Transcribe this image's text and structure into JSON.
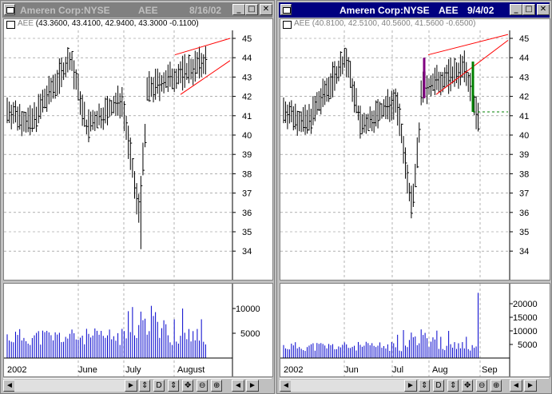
{
  "left": {
    "title": {
      "name": "Ameren Corp:NYSE",
      "symbol": "AEE",
      "date": "8/16/02"
    },
    "info": {
      "symbol": "AEE",
      "values": "(43.3600, 43.4100, 42.9400, 43.3000 -0.1100)"
    },
    "price_ticks": [
      "45",
      "44",
      "43",
      "42",
      "41",
      "40",
      "39",
      "38",
      "37",
      "36",
      "35",
      "34"
    ],
    "volume_ticks": [
      "10000",
      "5000"
    ],
    "x_labels": [
      "2002",
      "June",
      "July",
      "August"
    ],
    "toolbar": [
      "◄",
      "►",
      "⇕",
      "D",
      "⇕",
      "✥",
      "⊖",
      "⊕",
      "◄",
      "►"
    ]
  },
  "right": {
    "title": {
      "name": "Ameren Corp:NYSE",
      "symbol": "AEE",
      "date": "9/4/02"
    },
    "info": {
      "symbol": "AEE",
      "values": "(40.8100, 42.5100, 40.5600, 41.5600 -0.6500)"
    },
    "price_ticks": [
      "45",
      "44",
      "43",
      "42",
      "41",
      "40",
      "39",
      "38",
      "37",
      "36",
      "35",
      "34"
    ],
    "volume_ticks": [
      "20000",
      "15000",
      "10000",
      "5000"
    ],
    "x_labels": [
      "2002",
      "Jun",
      "Jul",
      "Aug",
      "Sep"
    ],
    "toolbar": [
      "◄",
      "►",
      "⇕",
      "D",
      "⇕",
      "✥",
      "⊖",
      "⊕",
      "◄",
      "►"
    ]
  },
  "colors": {
    "bars": "#000000",
    "volume": "#0000cc",
    "trendline": "#ff0000",
    "pole": "#800080",
    "target": "#008000",
    "grid": "#808080",
    "active_title": "#000080"
  }
}
